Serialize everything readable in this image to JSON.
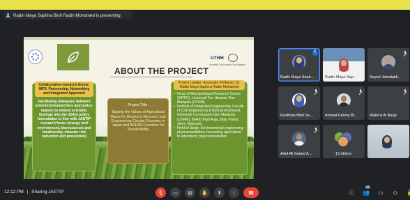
{
  "presenter_bar": {
    "text": "Radin Maya Saphira Binti Radin Mohamed is presenting"
  },
  "slide": {
    "title": "ABOUT THE PROJECT",
    "logo_right": "UTHM",
    "logo_sub": "Universiti Tun Hussein Onn Malaysia",
    "left_card": {
      "head": "Collaborative research theme: WP3. Partnership, Networking and Integrated Approach",
      "body": "Facilitating dialogues between scientists/researchers and policy-makers to embed scientific findings into the SDGs policy formulation in line with JASTIP research focus (energy and environment, bioresources and biodiversity, disaster risk reduction and prevention)"
    },
    "mid_card": {
      "head": "Project Title:",
      "body": "Tapping the Values of Agricultural Waste for Resource Recovery and Empowering Circular Economy in Japan And ASEAN Countries for Sustainability"
    },
    "right_card": {
      "head": "Project Leader: Associate Professor Dr. Radin Maya Saphira Radin Mohamed",
      "items": [
        "Head of Micropollutant Research Centre (MPRC), Universiti Tun Hussein Onn Malaysia (UTHM)",
        "Institute of Integrated Engineering, Faculty of Civil Engineering & Built Environment, Universiti Tun Hussein Onn Malaysia (UTHM), 86400 Parit Raja, Batu Pahat, Johor, Malaysia",
        "Field of Study: Environmental engineering; phytoremediation; harvesting agricultural to adsorbent; phycoremediation"
      ]
    }
  },
  "participants": [
    {
      "name": "Radin Maya Saph...",
      "speaking": true,
      "kind": "avatar"
    },
    {
      "name": "Radin Maya Sap...",
      "speaking": false,
      "kind": "video"
    },
    {
      "name": "Seyed Jamalaldi...",
      "speaking": false,
      "kind": "avatar"
    },
    {
      "name": "Rosfinda Binti Se...",
      "speaking": false,
      "kind": "avatar"
    },
    {
      "name": "Ahmad Fahmy Bi...",
      "speaking": false,
      "kind": "avatar"
    },
    {
      "name": "Walid A Al Bargi",
      "speaking": false,
      "kind": "avatar"
    },
    {
      "name": "Adel Ali Saeed A...",
      "speaking": false,
      "kind": "avatar"
    },
    {
      "name": "13 others",
      "speaking": false,
      "kind": "others"
    },
    {
      "name": "You",
      "speaking": false,
      "kind": "self"
    }
  ],
  "bottom_bar": {
    "time": "12:12 PM",
    "separator": "|",
    "sharing": "Sharing JASTIP",
    "participant_count": "20"
  },
  "colors": {
    "accent": "#1a73e8",
    "end_call": "#ea4335",
    "frame": "#e8e24a"
  }
}
